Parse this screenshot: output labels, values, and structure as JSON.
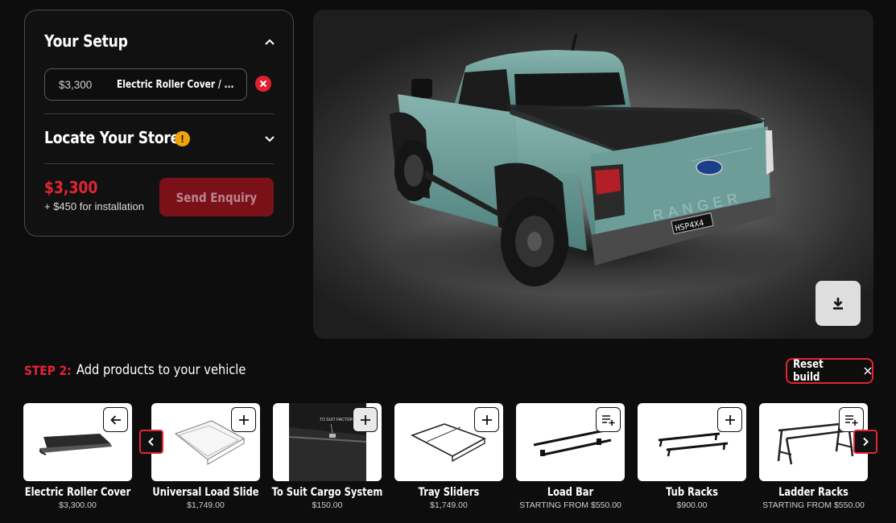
{
  "setup": {
    "title": "Your Setup",
    "selected_item": {
      "price": "$3,300",
      "name": "Electric Roller Cover / ..."
    },
    "store_title": "Locate Your Store",
    "total_price": "$3,300",
    "install_text": "+ $450 for installation",
    "enquiry_label": "Send Enquiry"
  },
  "viewer": {
    "plate_text": "HSP4X4",
    "tailgate_text": "RANGER"
  },
  "step": {
    "label": "STEP 2:",
    "text": "Add products to your vehicle",
    "reset_label": "Reset build"
  },
  "products": [
    {
      "name": "Electric Roller Cover",
      "price": "$3,300.00",
      "action_icon": "arrow-left-icon"
    },
    {
      "name": "Universal Load Slide",
      "price": "$1,749.00",
      "action_icon": "plus-icon"
    },
    {
      "name": "To Suit Cargo System",
      "price": "$150.00",
      "action_icon": "plus-icon",
      "image_caption": "TO SUIT FACTORY CARGO RAIL"
    },
    {
      "name": "Tray Sliders",
      "price": "$1,749.00",
      "action_icon": "plus-icon"
    },
    {
      "name": "Load Bar",
      "price": "STARTING FROM $550.00",
      "action_icon": "list-add-icon"
    },
    {
      "name": "Tub Racks",
      "price": "$900.00",
      "action_icon": "plus-icon"
    },
    {
      "name": "Ladder Racks",
      "price": "STARTING FROM $550.00",
      "action_icon": "list-add-icon"
    }
  ],
  "colors": {
    "accent_red": "#e42433",
    "panel_border": "#4a4a4a",
    "truck_body": "#6c9c98",
    "warning": "#f0a30a"
  }
}
